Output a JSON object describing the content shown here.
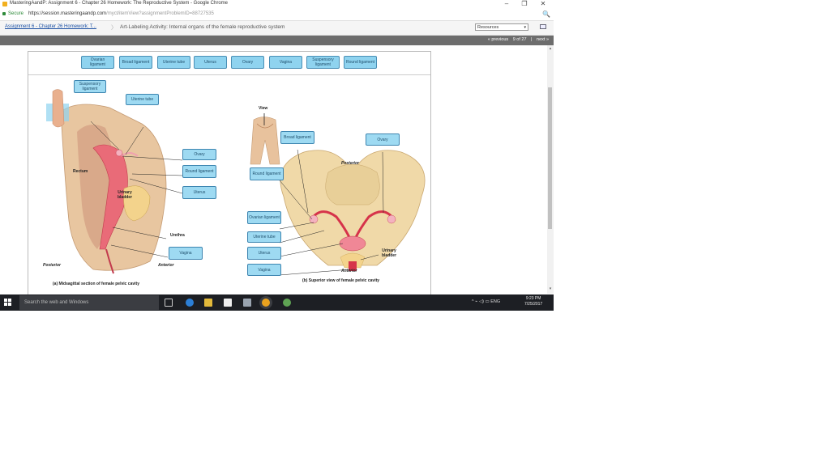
{
  "browser": {
    "tab_title": "MasteringAandP: Assignment 6 - Chapter 26 Homework: The Reproductive System - Google Chrome",
    "secure_label": "Secure",
    "url_main": "https://session.masteringaandp.com",
    "url_rest": "/myct/itemView?assignmentProblemID=88727535",
    "minimize": "–",
    "restore": "❐",
    "close": "✕",
    "zoom_icon": "🔍"
  },
  "header": {
    "breadcrumb_link": "Assignment 6 - Chapter 26 Homework: T...",
    "separator": "〉",
    "activity_title": "Art-Labeling Activity: Internal organs of the female reproductive system",
    "resources_label": "Resources",
    "dropdown_arrow": "▾"
  },
  "pager": {
    "previous": "« previous",
    "position": "9 of 27",
    "separator": "|",
    "next": "next »"
  },
  "label_bank": [
    "Ovarian ligament",
    "Broad ligament",
    "Uterine tube",
    "Uterus",
    "Ovary",
    "Vagina",
    "Suspensory ligament",
    "Round ligament"
  ],
  "figure_a": {
    "labels": {
      "suspensory": "Suspensory ligament",
      "uterine_tube": "Uterine tube",
      "ovary": "Ovary",
      "round": "Round ligament",
      "uterus": "Uterus",
      "vagina": "Vagina"
    },
    "text": {
      "rectum": "Rectum",
      "bladder": "Urinary bladder",
      "urethra": "Urethra",
      "posterior": "Posterior",
      "anterior": "Anterior"
    },
    "caption": "(a) Midsagittal section of female pelvic cavity"
  },
  "figure_b": {
    "labels": {
      "broad": "Broad ligament",
      "ovary": "Ovary",
      "round": "Round ligament",
      "ovarian": "Ovarian ligament",
      "uterine_tube": "Uterine tube",
      "uterus": "Uterus",
      "vagina": "Vagina"
    },
    "text": {
      "view": "View",
      "posterior": "Posterior",
      "anterior": "Anterior",
      "bladder": "Urinary bladder"
    },
    "caption": "(b) Superior view of female pelvic cavity"
  },
  "taskbar": {
    "search_placeholder": "Search the web and Windows",
    "tray_text": "^  ⌁  ◁)  ▭  ENG",
    "time": "9:23 PM",
    "date": "7/25/2017"
  },
  "colors": {
    "chip_fill": "#8fd3ef",
    "chip_border": "#4a8fb5",
    "nav_strip": "#6d6d6d",
    "taskbar": "#1d1f24",
    "link": "#1a4fa3"
  }
}
